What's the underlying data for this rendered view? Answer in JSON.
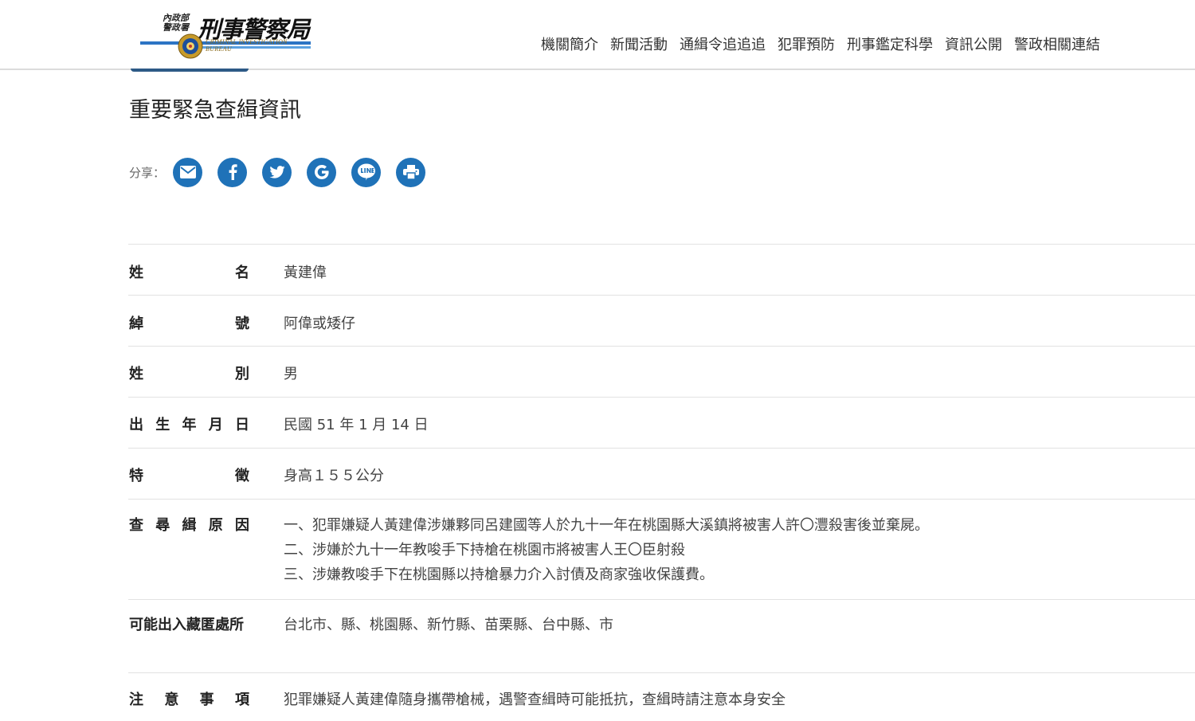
{
  "header": {
    "logo": {
      "ministry_lines": [
        "內政部",
        "警政署"
      ],
      "bureau_name": "刑事警察局",
      "bureau_name_en": "CRIMINAL INVESTIGATION BUREAU"
    },
    "nav": [
      "機關簡介",
      "新聞活動",
      "通緝令追追追",
      "犯罪預防",
      "刑事鑑定科學",
      "資訊公開",
      "警政相關連結"
    ]
  },
  "page": {
    "title": "重要緊急查緝資訊"
  },
  "share": {
    "label": "分享：",
    "buttons": [
      "email-icon",
      "facebook-icon",
      "twitter-icon",
      "google-icon",
      "line-icon",
      "print-icon"
    ],
    "button_color": "#1f72b8"
  },
  "info_rows": [
    {
      "label_chars": [
        "姓",
        "名"
      ],
      "values": [
        "黃建偉"
      ]
    },
    {
      "label_chars": [
        "綽",
        "號"
      ],
      "values": [
        "阿偉或矮仔"
      ]
    },
    {
      "label_chars": [
        "姓",
        "別"
      ],
      "values": [
        "男"
      ]
    },
    {
      "label_chars": [
        "出",
        "生",
        "年",
        "月",
        "日"
      ],
      "values": [
        "民國 51 年 1 月 14 日"
      ]
    },
    {
      "label_chars": [
        "特",
        "徵"
      ],
      "values": [
        "身高１５５公分"
      ]
    },
    {
      "label_chars": [
        "查",
        "尋",
        "緝",
        "原",
        "因"
      ],
      "values": [
        "一、犯罪嫌疑人黃建偉涉嫌夥同呂建國等人於九十一年在桃園縣大溪鎮將被害人許〇灃殺害後並棄屍。",
        "二、涉嫌於九十一年教唆手下持槍在桃園市將被害人王〇臣射殺",
        "三、涉嫌教唆手下在桃園縣以持槍暴力介入討債及商家強收保護費。"
      ]
    },
    {
      "label_text": "可能出入藏匿處所",
      "values": [
        "台北市、縣、桃園縣、新竹縣、苗栗縣、台中縣、市"
      ]
    },
    {
      "label_chars": [
        "注",
        "意",
        "事",
        "項"
      ],
      "values": [
        "犯罪嫌疑人黃建偉隨身攜帶槍械，遇警查緝時可能抵抗，查緝時請注意本身安全"
      ]
    }
  ]
}
